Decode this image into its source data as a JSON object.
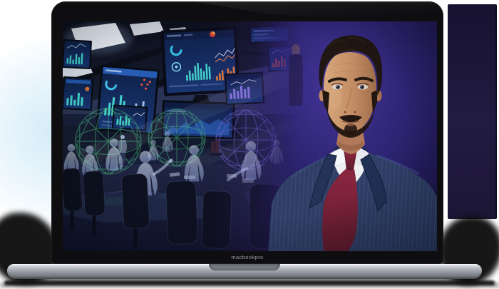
{
  "device_frame": {
    "brand_label": "macbookpro",
    "bezel_color": "#0e0e10",
    "base_color": "#9aa0a6",
    "shadow_color": "#0b0b0b",
    "backdrop_panel_color": "#1f1840",
    "glow_color": "#cfe7f5"
  },
  "screen_scene": {
    "room_bg_left": "#2a3654",
    "room_bg_right": "#2d2368",
    "ceiling_color": "#0b0f19",
    "light_panel_color": "#f2f7fd",
    "monitor_frame_color": "#070b13",
    "monitor_screen_color": "#12295a",
    "accent_teal": "#43d6cc",
    "accent_pale": "#bfe9ff",
    "accent_orange": "#f08036",
    "accent_red": "#dd4f35",
    "accent_violet": "#8a76e8",
    "wireframe_green": "#49bd7d",
    "wireframe_violet": "#7a6ae0",
    "hologram_color": "#bcd2f5",
    "overlay_purple": "#4c2a96",
    "portrait": {
      "suit_color": "#2e3e66",
      "lapel_color": "#243459",
      "shirt_color": "#edeff3",
      "tie_color": "#8c2740",
      "skin_color": "#c08a62",
      "hair_color": "#201612",
      "backdrop_center": "#45369a",
      "backdrop_edge": "#161140"
    }
  }
}
